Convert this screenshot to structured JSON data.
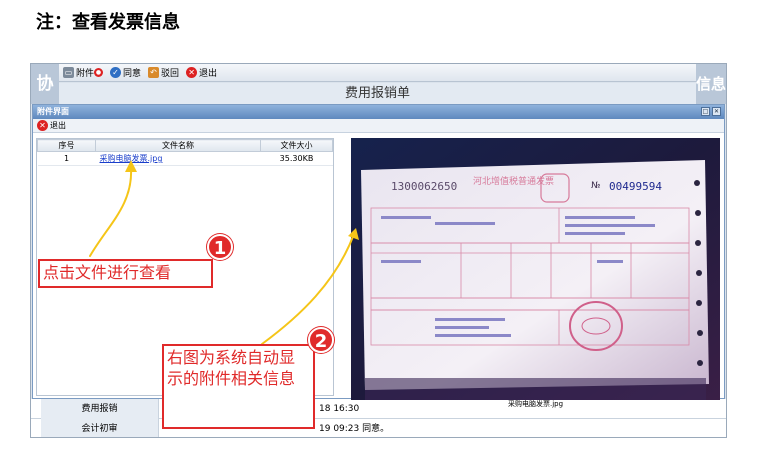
{
  "note": {
    "title": "注：查看发票信息"
  },
  "background_app": {
    "side_left": "协",
    "side_right": "信息",
    "toolbar": [
      {
        "label": "附件",
        "icon": "printer-icon"
      },
      {
        "label": "同意",
        "icon": "approve-icon"
      },
      {
        "label": "驳回",
        "icon": "return-icon"
      },
      {
        "label": "退出",
        "icon": "exit-icon"
      }
    ],
    "form_title": "费用报销单",
    "rows": [
      {
        "label": "费用报销",
        "value": "18 16:30"
      },
      {
        "label": "会计初审",
        "value": "19 09:23 同意。"
      }
    ]
  },
  "dialog": {
    "title": "附件界面",
    "exit_label": "退出",
    "table": {
      "headers": [
        "序号",
        "文件名称",
        "文件大小"
      ],
      "rows": [
        {
          "index": "1",
          "name": "采购电脑发票.jpg",
          "size": "35.30KB"
        }
      ]
    },
    "preview_caption": "采购电脑发票.jpg",
    "invoice": {
      "code": "1300062650",
      "heading": "河北增值税普通发票",
      "no_label": "№",
      "number": "00499594"
    }
  },
  "annotations": {
    "callout1": "点击文件进行查看",
    "callout2": "右图为系统自动显示的附件相关信息",
    "badge1": "1",
    "badge2": "2",
    "color": "#e02a2a",
    "arrow_color": "#f5c518"
  }
}
